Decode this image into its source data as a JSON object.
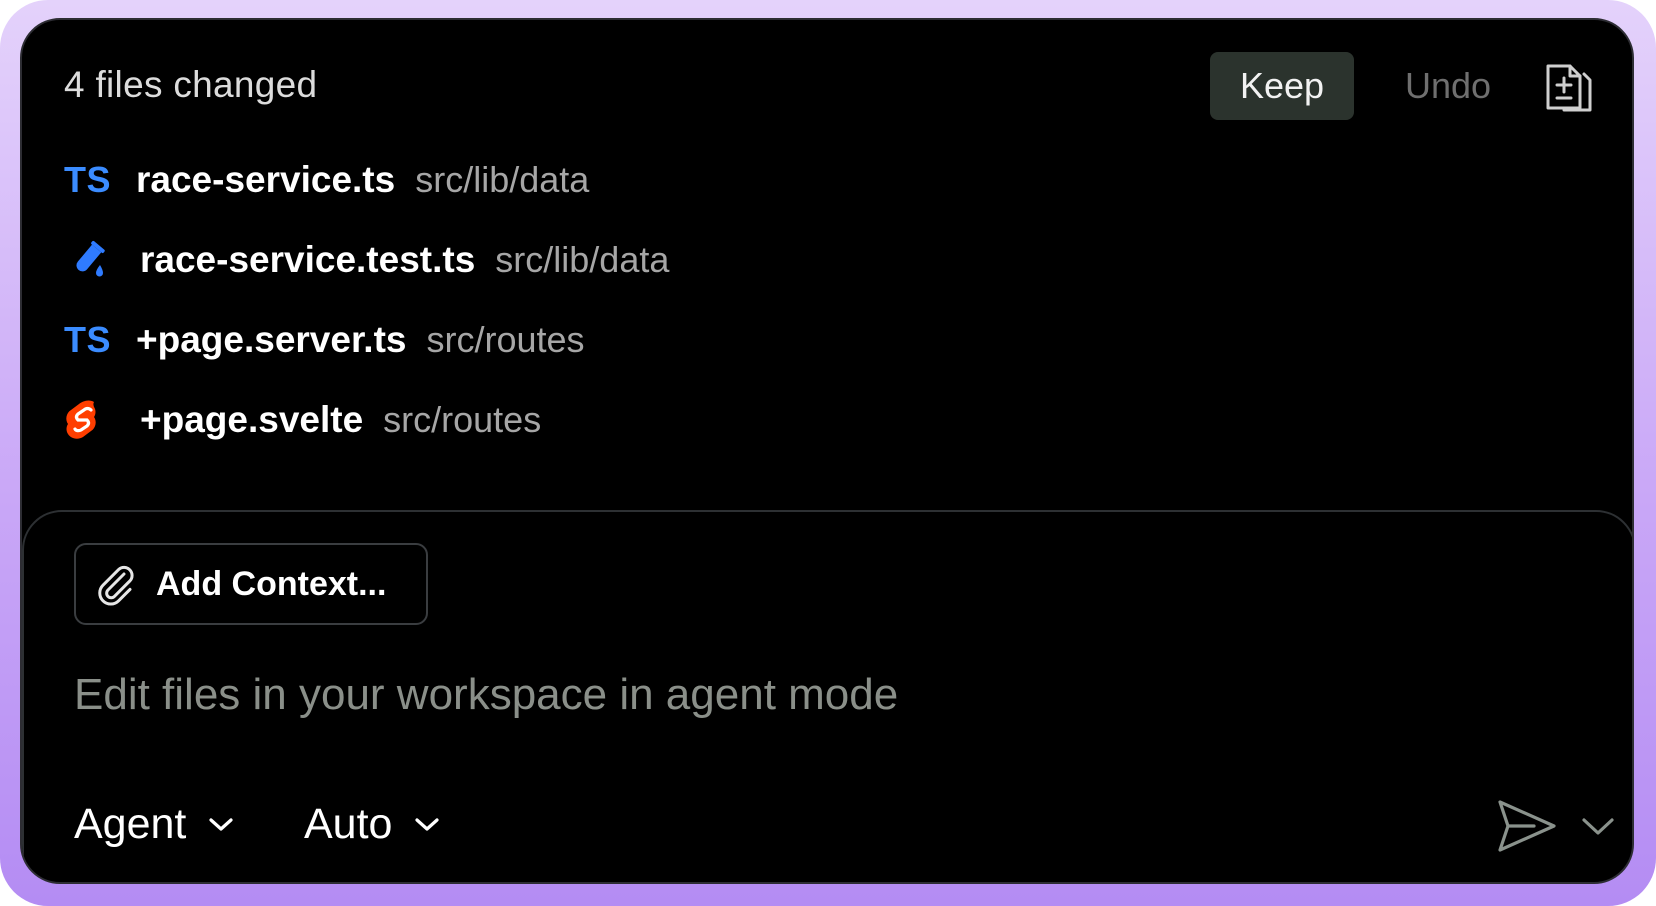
{
  "header": {
    "title": "4 files changed",
    "keep_label": "Keep",
    "undo_label": "Undo",
    "diff_icon": "file-diff-icon"
  },
  "files": [
    {
      "icon": "typescript-icon",
      "icon_text": "TS",
      "name": "race-service.ts",
      "path": "src/lib/data"
    },
    {
      "icon": "test-tube-icon",
      "icon_text": "",
      "name": "race-service.test.ts",
      "path": "src/lib/data"
    },
    {
      "icon": "typescript-icon",
      "icon_text": "TS",
      "name": "+page.server.ts",
      "path": "src/routes"
    },
    {
      "icon": "svelte-icon",
      "icon_text": "",
      "name": "+page.svelte",
      "path": "src/routes"
    }
  ],
  "composer": {
    "add_context_label": "Add Context...",
    "placeholder": "Edit files in your workspace in agent mode",
    "mode_label": "Agent",
    "model_label": "Auto"
  },
  "colors": {
    "frame_gradient_top": "#e4d2fb",
    "frame_gradient_bottom": "#b48cf3",
    "panel_bg": "#000000",
    "ts_blue": "#3b8cff",
    "svelte_red": "#ff3e00",
    "keep_bg": "#2b332d"
  }
}
